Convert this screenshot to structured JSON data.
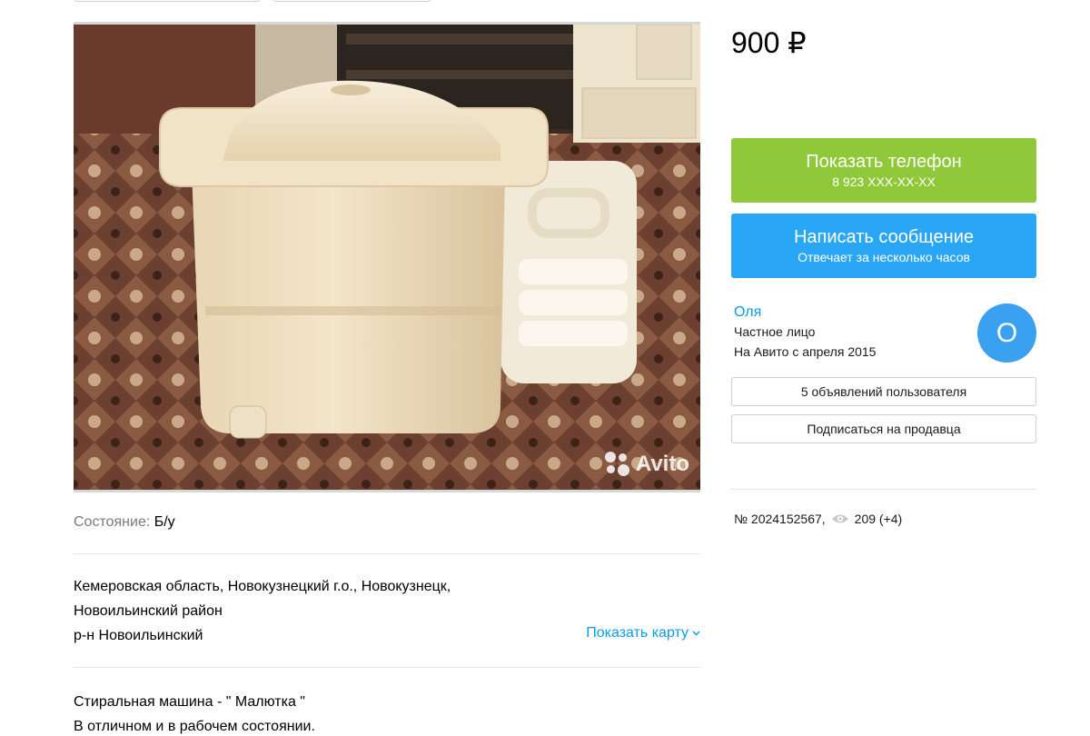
{
  "listing": {
    "price": "900 ₽",
    "condition_label": "Состояние:",
    "condition_value": "Б/у",
    "address_line1": "Кемеровская область, Новокузнецкий г.о., Новокузнецк,",
    "address_line2": "Новоильинский район",
    "address_line3": "р-н Новоильинский",
    "show_map": "Показать карту",
    "description_line1": "Стиральная машина - \" Малютка \"",
    "description_line2": "В отличном и в рабочем состоянии.",
    "watermark": "Avito"
  },
  "actions": {
    "phone_label": "Показать телефон",
    "phone_number": "8 923 XXX-XX-XX",
    "message_label": "Написать сообщение",
    "message_sub": "Отвечает за несколько часов"
  },
  "seller": {
    "name": "Оля",
    "type": "Частное лицо",
    "since": "На Авито с апреля 2015",
    "avatar_letter": "О",
    "ads_button": "5 объявлений пользователя",
    "subscribe_button": "Подписаться на продавца"
  },
  "meta": {
    "number": "№ 2024152567,",
    "views": "209 (+4)"
  },
  "colors": {
    "green": "#8fc93a",
    "blue": "#2aa6f6",
    "link": "#0a9ce5"
  }
}
